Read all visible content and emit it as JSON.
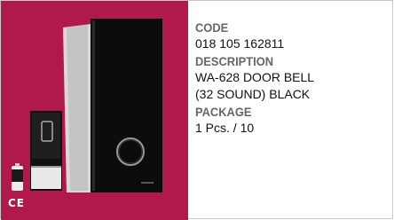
{
  "product": {
    "code_label": "CODE",
    "code_value": "018 105 162811",
    "description_label": "DESCRIPTION",
    "description_line1": "WA-628 DOOR BELL",
    "description_line2": "(32 SOUND) BLACK",
    "package_label": "PACKAGE",
    "package_value": "1 Pcs. / 10"
  },
  "image": {
    "background_color": "#b01a4b",
    "ce_mark": "CE",
    "icons": [
      "doorbell-chime-unit",
      "doorbell-push-button",
      "battery"
    ]
  }
}
